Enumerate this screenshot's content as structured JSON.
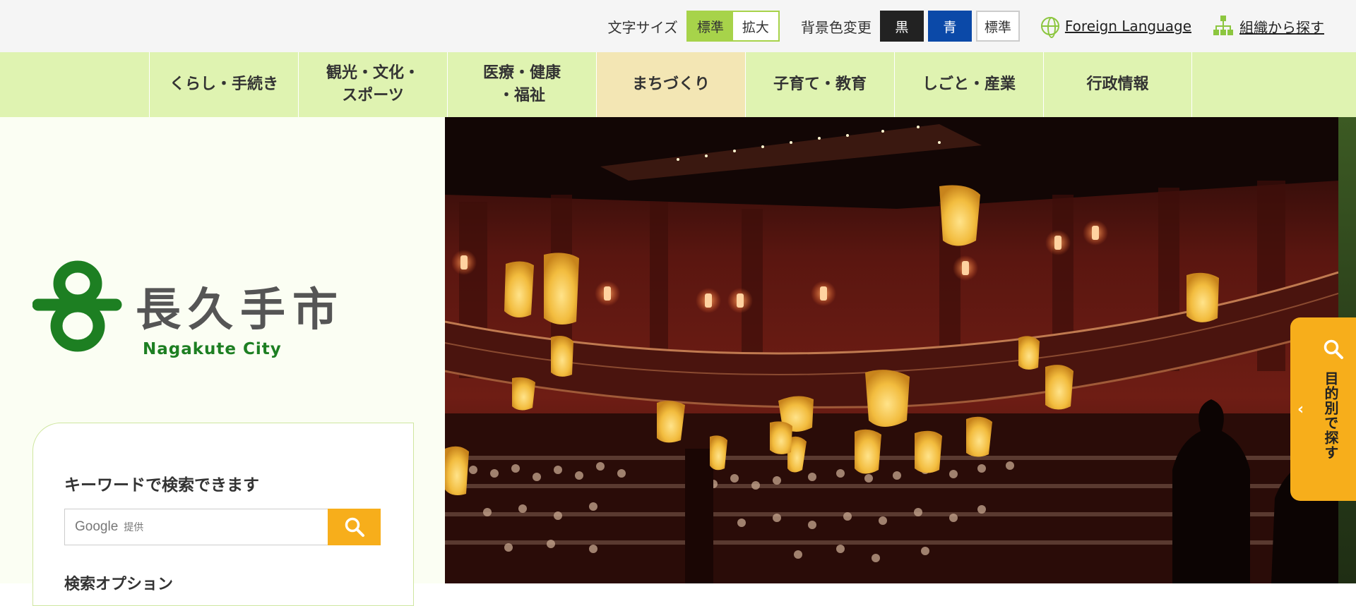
{
  "topbar": {
    "font_size_label": "文字サイズ",
    "font_size_options": [
      "標準",
      "拡大"
    ],
    "bg_color_label": "背景色変更",
    "bg_color_options": [
      "黒",
      "青",
      "標準"
    ],
    "foreign_language": "Foreign Language",
    "org_search": "組織から探す"
  },
  "nav": {
    "items": [
      {
        "label": "くらし・手続き"
      },
      {
        "label": "観光・文化・\nスポーツ"
      },
      {
        "label": "医療・健康\n・福祉"
      },
      {
        "label": "まちづくり"
      },
      {
        "label": "子育て・教育"
      },
      {
        "label": "しごと・産業"
      },
      {
        "label": "行政情報"
      }
    ]
  },
  "logo": {
    "name_ja": "長久手市",
    "name_en": "Nagakute City"
  },
  "search": {
    "title": "キーワードで検索できます",
    "placeholder_brand": "Google",
    "placeholder_suffix": "提供",
    "options_label": "検索オプション"
  },
  "float_tab": {
    "label": "目的別で探す"
  },
  "colors": {
    "accent_green": "#a7d34a",
    "nav_bg": "#dff3b1",
    "active_nav": "#f3e6b4",
    "search_orange": "#f7ae1b",
    "logo_green": "#1d7f22"
  }
}
